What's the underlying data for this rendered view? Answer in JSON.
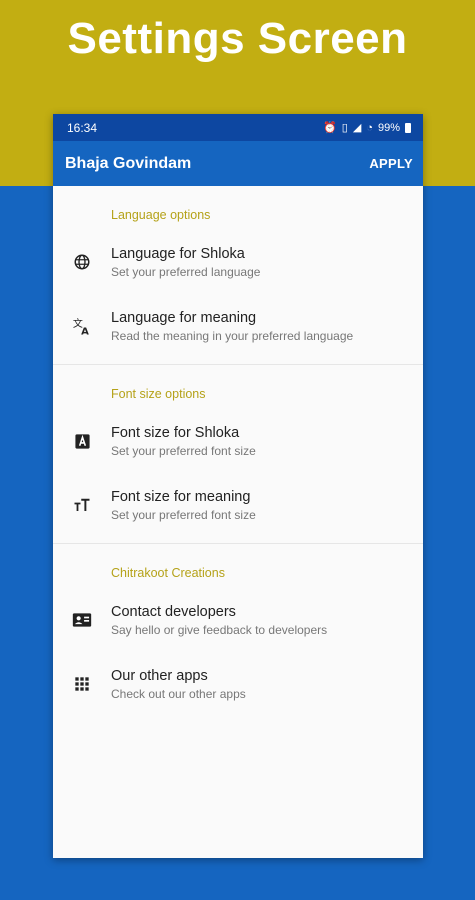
{
  "promo": {
    "title": "Settings Screen"
  },
  "status_bar": {
    "time": "16:34",
    "battery": "99%"
  },
  "app_bar": {
    "title": "Bhaja Govindam",
    "action": "APPLY"
  },
  "sections": [
    {
      "header": "Language options",
      "items": [
        {
          "icon": "globe-icon",
          "title": "Language for Shloka",
          "subtitle": "Set your preferred language"
        },
        {
          "icon": "translate-icon",
          "title": "Language for meaning",
          "subtitle": "Read the meaning in your preferred language"
        }
      ]
    },
    {
      "header": "Font size options",
      "items": [
        {
          "icon": "font-box-icon",
          "title": "Font size for Shloka",
          "subtitle": "Set your preferred font size"
        },
        {
          "icon": "text-size-icon",
          "title": "Font size for meaning",
          "subtitle": "Set your preferred font size"
        }
      ]
    },
    {
      "header": "Chitrakoot Creations",
      "items": [
        {
          "icon": "contact-card-icon",
          "title": "Contact developers",
          "subtitle": "Say hello or give feedback to developers"
        },
        {
          "icon": "apps-grid-icon",
          "title": "Our other apps",
          "subtitle": "Check out our other apps"
        }
      ]
    }
  ],
  "colors": {
    "brand_blue": "#1565c0",
    "status_blue": "#0d47a1",
    "accent_gold": "#c2ae12",
    "section_text": "#b5a219"
  }
}
